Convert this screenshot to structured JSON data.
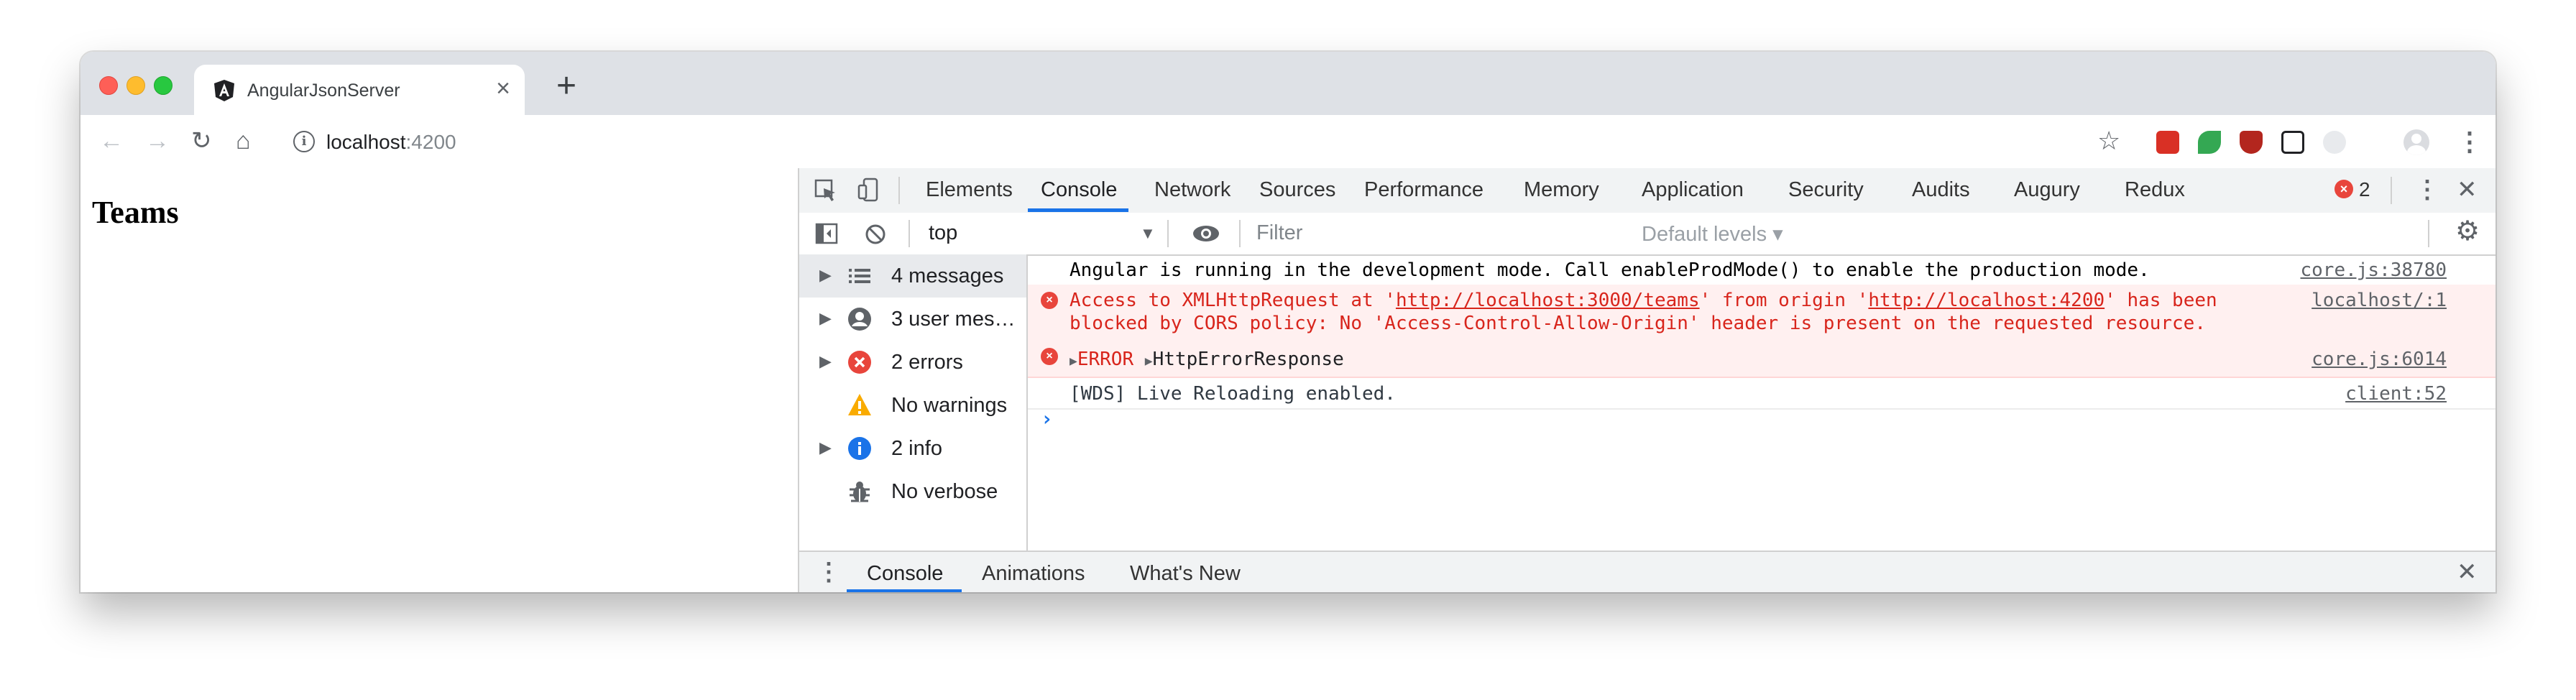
{
  "browser": {
    "tab_title": "AngularJsonServer",
    "tab_close": "×",
    "new_tab": "+",
    "url_host": "localhost",
    "url_port": ":4200"
  },
  "page": {
    "heading": "Teams"
  },
  "devtools": {
    "tabs": [
      "Elements",
      "Console",
      "Network",
      "Sources",
      "Performance",
      "Memory",
      "Application",
      "Security",
      "Audits",
      "Augury",
      "Redux"
    ],
    "active_tab": "Console",
    "error_count": "2",
    "context": "top",
    "filter_placeholder": "Filter",
    "levels": "Default levels ▾",
    "sidebar": [
      {
        "label": "4 messages",
        "icon": "list-icon"
      },
      {
        "label": "3 user mes…",
        "icon": "user-icon"
      },
      {
        "label": "2 errors",
        "icon": "error-icon"
      },
      {
        "label": "No warnings",
        "icon": "warning-icon"
      },
      {
        "label": "2 info",
        "icon": "info-icon"
      },
      {
        "label": "No verbose",
        "icon": "bug-icon"
      }
    ],
    "messages": {
      "m1": {
        "text": "Angular is running in the development mode. Call enableProdMode() to enable the production mode.",
        "source": "core.js:38780"
      },
      "m2": {
        "line1_a": "Access to XMLHttpRequest at '",
        "link1": "http://localhost:3000/teams",
        "line1_b": "' from origin '",
        "link2": "http://localhost:4200",
        "line1_c": "' has been",
        "line2": "blocked by CORS policy: No 'Access-Control-Allow-Origin' header is present on the requested resource.",
        "source": "localhost/:1"
      },
      "m3": {
        "label": "ERROR",
        "object": "HttpErrorResponse",
        "source": "core.js:6014"
      },
      "m4": {
        "text": "[WDS] Live Reloading enabled.",
        "source": "client:52"
      }
    },
    "drawer_tabs": [
      "Console",
      "Animations",
      "What's New"
    ]
  },
  "colors": {
    "accent": "#1a73e8",
    "error": "#d8251c",
    "error_bg": "#fff0f0"
  }
}
